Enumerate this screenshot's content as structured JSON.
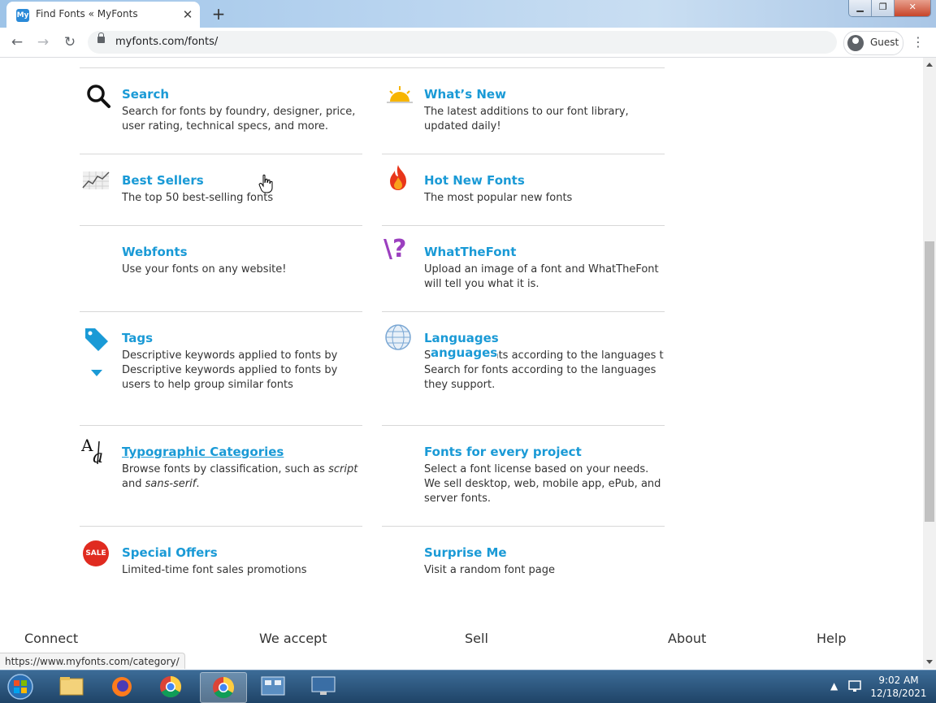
{
  "browser": {
    "tab_title": "Find Fonts « MyFonts",
    "tab_favicon_text": "My",
    "url": "myfonts.com/fonts/",
    "profile_label": "Guest",
    "status_url": "https://www.myfonts.com/category/"
  },
  "items_left": [
    {
      "title": "Search",
      "desc": "Search for fonts by foundry, designer, price, user rating, technical specs, and more.",
      "icon": "magnifier-icon"
    },
    {
      "title": "Best Sellers",
      "desc": "The top 50 best-selling fonts",
      "icon": "chart-icon"
    },
    {
      "title": "Webfonts",
      "desc": "Use your fonts on any website!",
      "icon": ""
    },
    {
      "title": "Tags",
      "desc": "Descriptive keywords applied to fonts by users to helc",
      "desc2": "Descriptive keywords applied to fonts by users to help group similar fonts",
      "icon": "tag-icon"
    },
    {
      "title": "Typographic Categories",
      "desc_prefix": "Browse fonts by classification, such as ",
      "desc_em1": "script",
      "desc_mid": " and ",
      "desc_em2": "sans-serif",
      "desc_suffix": ".",
      "icon": "type-category-icon"
    },
    {
      "title": "Special Offers",
      "desc": "Limited-time font sales promotions",
      "icon": "sale-icon",
      "icon_text": "SALE"
    }
  ],
  "items_right": [
    {
      "title": "What’s New",
      "desc": "The latest additions to our font library, updated daily!",
      "icon": "sunrise-icon"
    },
    {
      "title": "Hot New Fonts",
      "desc": "The most popular new fonts",
      "icon": "flame-icon"
    },
    {
      "title": "WhatTheFont",
      "desc": "Upload an image of a font and WhatTheFont will tell you what it is.",
      "icon": "whatthefont-icon",
      "icon_text": "\\?"
    },
    {
      "title": "Languages",
      "desc": "Search for fonts according to the languages t",
      "title2": "anguages",
      "desc2": "Search for fonts according to the languages they support.",
      "icon": "globe-icon"
    },
    {
      "title": "Fonts for every project",
      "desc": "Select a font license based on your needs. We sell desktop, web, mobile app, ePub, and server fonts.",
      "icon": ""
    },
    {
      "title": "Surprise Me",
      "desc": "Visit a random font page",
      "icon": ""
    }
  ],
  "footer": {
    "connect": "Connect",
    "we_accept": "We accept",
    "sell": "Sell",
    "about": "About",
    "help": "Help"
  },
  "taskbar": {
    "time": "9:02 AM",
    "date": "12/18/2021"
  }
}
